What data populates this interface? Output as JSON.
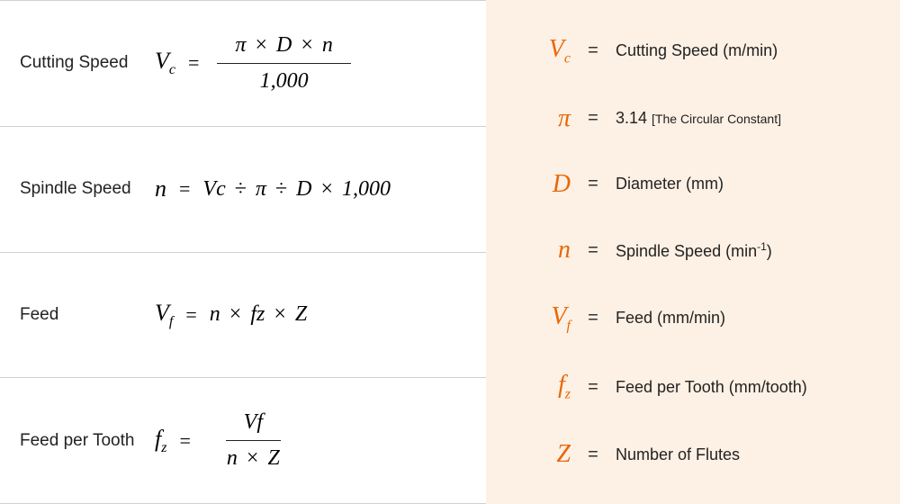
{
  "formulas": [
    {
      "label": "Cutting Speed",
      "lhs_html": "<span class='sym-main'>V<span class='sub'>c</span></span>",
      "rhs_type": "fraction",
      "numerator_html": "<span>π</span><span class='op'>×</span><span>D</span><span class='op'>×</span><span>n</span>",
      "denominator_html": "<span class='thousand'>1,000</span>"
    },
    {
      "label": "Spindle Speed",
      "lhs_html": "<span class='sym-main'>n</span>",
      "rhs_type": "inline",
      "rhs_html": "<span>V<span class='sub'>c</span></span><span class='op'>÷</span><span>π</span><span class='op'>÷</span><span>D</span><span class='op'>×</span><span class='thousand'>1,000</span>"
    },
    {
      "label": "Feed",
      "lhs_html": "<span class='sym-main'>V<span class='sub'>f</span></span>",
      "rhs_type": "inline",
      "rhs_html": "<span>n</span><span class='op'>×</span><span>f<span class='sub'>z</span></span><span class='op'>×</span><span>Z</span>"
    },
    {
      "label": "Feed per Tooth",
      "lhs_html": "<span class='sym-main'>f<span class='sub'>z</span></span>",
      "rhs_type": "fraction",
      "numerator_html": "<span>V<span class='sub'>f</span></span>",
      "denominator_html": "<span>n</span><span class='op'>×</span><span>Z</span>"
    }
  ],
  "legend": [
    {
      "sym_html": "V<span class='sub'>c</span>",
      "desc_html": "Cutting Speed (m/min)"
    },
    {
      "sym_html": "π",
      "desc_html": "3.14 <span class='note'>[The Circular Constant]</span>"
    },
    {
      "sym_html": "D",
      "desc_html": "Diameter (mm)"
    },
    {
      "sym_html": "n",
      "desc_html": "Spindle Speed (min<sup>-1</sup>)"
    },
    {
      "sym_html": "V<span class='sub'>f</span>",
      "desc_html": "Feed (mm/min)"
    },
    {
      "sym_html": "f<span class='sub'>z</span>",
      "desc_html": "Feed per Tooth (mm/tooth)"
    },
    {
      "sym_html": "Z",
      "desc_html": "Number of Flutes"
    }
  ],
  "eq": "="
}
